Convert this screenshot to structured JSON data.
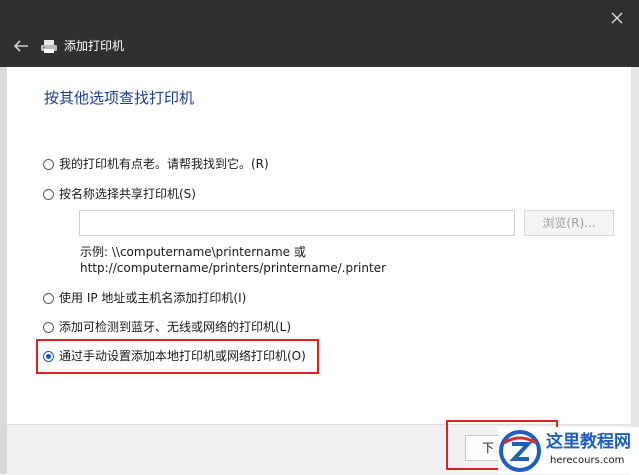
{
  "window": {
    "title": "添加打印机",
    "back_icon": "arrow-left-icon",
    "printer_icon": "printer-icon",
    "close_icon": "close-icon"
  },
  "page": {
    "heading": "按其他选项查找打印机"
  },
  "options": [
    {
      "label": "我的打印机有点老。请帮我找到它。(R)",
      "checked": false
    },
    {
      "label": "按名称选择共享打印机(S)",
      "checked": false
    },
    {
      "label": "使用 IP 地址或主机名添加打印机(I)",
      "checked": false
    },
    {
      "label": "添加可检测到蓝牙、无线或网络的打印机(L)",
      "checked": false
    },
    {
      "label": "通过手动设置添加本地打印机或网络打印机(O)",
      "checked": true
    }
  ],
  "share": {
    "input_value": "",
    "browse_label": "浏览(R)...",
    "example_line1": "示例: \\\\computername\\printername 或",
    "example_line2": "http://computername/printers/printername/.printer"
  },
  "footer": {
    "next_label": "下"
  },
  "watermark": {
    "title": "这里教程网",
    "url": "herecours.com"
  },
  "colors": {
    "heading": "#1b3f8f",
    "highlight": "#e02020",
    "titlebar": "#303030",
    "accent": "#1a56c4"
  }
}
